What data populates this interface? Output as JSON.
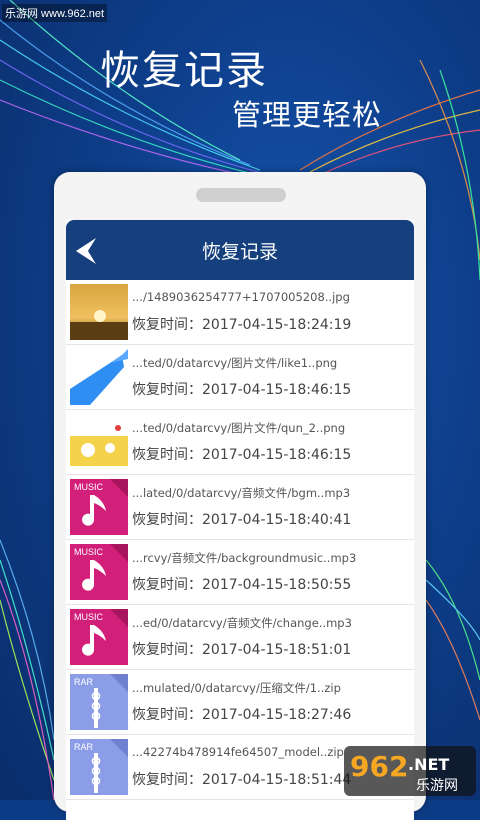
{
  "watermark": "乐游网 www.962.net",
  "headline": {
    "line1": "恢复记录",
    "line2": "管理更轻松"
  },
  "appbar": {
    "title": "恢复记录"
  },
  "time_label": "恢复时间：",
  "records": [
    {
      "thumb": "sunset-photo",
      "path": ".../1489036254777+1707005208..jpg",
      "time": "2017-04-15-18:24:19"
    },
    {
      "thumb": "blue-image",
      "path": "...ted/0/datarcvy/图片文件/like1..png",
      "time": "2017-04-15-18:46:15"
    },
    {
      "thumb": "cartoon-image",
      "path": "...ted/0/datarcvy/图片文件/qun_2..png",
      "time": "2017-04-15-18:46:15"
    },
    {
      "thumb": "music",
      "path": "...lated/0/datarcvy/音频文件/bgm..mp3",
      "time": "2017-04-15-18:40:41"
    },
    {
      "thumb": "music",
      "path": "...rcvy/音频文件/backgroundmusic..mp3",
      "time": "2017-04-15-18:50:55"
    },
    {
      "thumb": "music",
      "path": "...ed/0/datarcvy/音频文件/change..mp3",
      "time": "2017-04-15-18:51:01"
    },
    {
      "thumb": "rar",
      "path": "...mulated/0/datarcvy/压缩文件/1..zip",
      "time": "2017-04-15-18:27:46"
    },
    {
      "thumb": "rar",
      "path": "...42274b478914fe64507_model..zip",
      "time": "2017-04-15-18:51:44"
    }
  ],
  "badges": {
    "music": "MUSIC",
    "rar": "RAR"
  },
  "brand": {
    "number": "962",
    "suffix": ".NET",
    "tagline": "乐游网"
  },
  "colors": {
    "appbar": "#153f7d",
    "music": "#d2207a",
    "rar": "#8c9de8",
    "background": "#0d3c86"
  }
}
